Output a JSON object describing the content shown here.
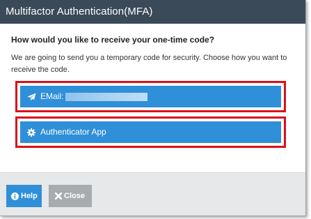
{
  "dialog": {
    "title": "Multifactor Authentication(MFA)"
  },
  "content": {
    "question": "How would you like to receive your one-time code?",
    "explanation": "We are going to send you a temporary code for security. Choose how you want to receive the code."
  },
  "options": [
    {
      "label": "EMail:",
      "icon": "paper-plane-icon",
      "value_masked": true
    },
    {
      "label": "Authenticator App",
      "icon": "gear-icon"
    }
  ],
  "footer": {
    "help_label": "Help",
    "help_icon": "info-circle-icon",
    "close_label": "Close",
    "close_icon": "x-icon"
  },
  "colors": {
    "titlebar": "#3b4a58",
    "primary_button": "#2f8fd8",
    "highlight_border": "#d9121b",
    "close_button": "#a8acaf",
    "footer_bg": "#e6e8ea"
  }
}
